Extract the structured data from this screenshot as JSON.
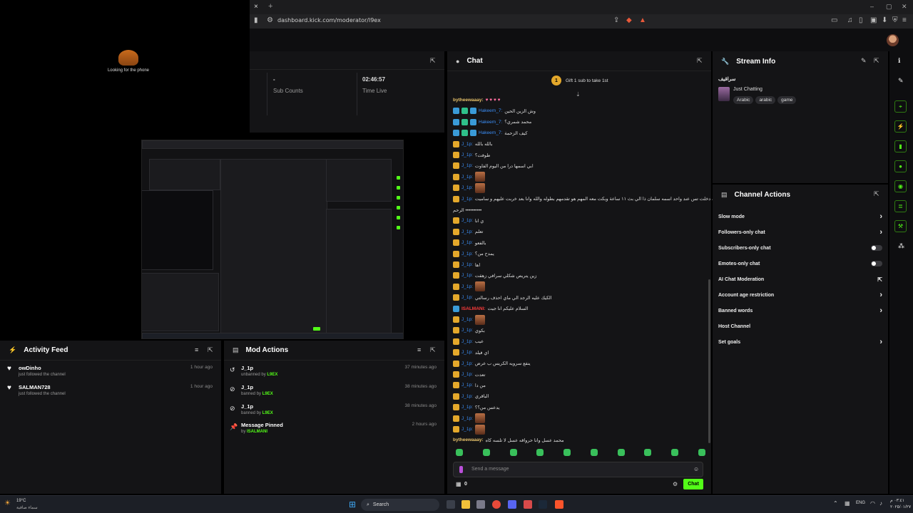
{
  "browser": {
    "url": "dashboard.kick.com/moderator/l9ex",
    "close_glyph": "×",
    "new_tab_glyph": "+"
  },
  "loading": {
    "text": "Looking for the phone"
  },
  "stats": {
    "sub_counts_value": "-",
    "sub_counts_label": "Sub Counts",
    "time_live_value": "02:46:57",
    "time_live_label": "Time Live"
  },
  "activity": {
    "title": "Activity Feed",
    "items": [
      {
        "name": "owDinho",
        "sub": "just followed the channel",
        "time": "1 hour ago"
      },
      {
        "name": "SALMAN728",
        "sub": "just followed the channel",
        "time": "1 hour ago"
      }
    ]
  },
  "mod_actions": {
    "title": "Mod Actions",
    "items": [
      {
        "user": "J_1p",
        "action": "unbanned by",
        "by": "L9EX",
        "time": "37 minutes ago"
      },
      {
        "user": "J_1p",
        "action": "banned by",
        "by": "L9EX",
        "time": "38 minutes ago"
      },
      {
        "user": "J_1p",
        "action": "banned by",
        "by": "L9EX",
        "time": "38 minutes ago"
      },
      {
        "user": "Message Pinned",
        "action": "by",
        "by": "ISALMANI",
        "time": "2 hours ago"
      }
    ]
  },
  "chat": {
    "title": "Chat",
    "gift_text": "Gift 1 sub to take 1st",
    "gift_count": "1",
    "messages": [
      {
        "user": "bytheewaaay:",
        "text": "",
        "type": "gold"
      },
      {
        "user": "Hakeem_7:",
        "text": "وش الزين الحين",
        "type": "blue"
      },
      {
        "user": "Hakeem_7:",
        "text": "محمد شمري؟",
        "type": "blue"
      },
      {
        "user": "Hakeem_7:",
        "text": "كيف الزحمة",
        "type": "blue"
      },
      {
        "user": "J_1p:",
        "text": "بالله بالله",
        "type": "crown"
      },
      {
        "user": "J_1p:",
        "text": "طوفت؟",
        "type": "crown"
      },
      {
        "user": "J_1p:",
        "text": "ابي اسمها درا من اليوم الفاوت",
        "type": "crown"
      },
      {
        "user": "J_1p:",
        "text": "",
        "type": "crown-emote"
      },
      {
        "user": "J_1p:",
        "text": "",
        "type": "crown-emote"
      },
      {
        "user": "J_1p:",
        "text": "تخيل لو انصحك دخلت تس عند واحد اسمه سلمان ذا الي بث ١١ ساعة وبكت معه المهم هو تقدمهم بطوله والله وانا بعد خربت عليهم و ساميت",
        "type": "crown"
      },
      {
        "user": "",
        "text": "الرحم ••••••••••",
        "type": "wrap"
      },
      {
        "user": "J_1p:",
        "text": "ي انا",
        "type": "crown"
      },
      {
        "user": "J_1p:",
        "text": "تعلم",
        "type": "crown"
      },
      {
        "user": "J_1p:",
        "text": "بالفعو",
        "type": "crown"
      },
      {
        "user": "J_1p:",
        "text": "يمدح من؟",
        "type": "crown"
      },
      {
        "user": "J_1p:",
        "text": "اها",
        "type": "crown"
      },
      {
        "user": "J_1p:",
        "text": "زين يتريص شكلي سرافي زهقت",
        "type": "crown"
      },
      {
        "user": "J_1p:",
        "text": "",
        "type": "crown-emote"
      },
      {
        "user": "J_1p:",
        "text": "الكيك عليه الرجد الي ماي احذف رسالتي",
        "type": "crown"
      },
      {
        "user": "ISALMANI:",
        "text": "السلام عليكم انا جيت",
        "type": "red"
      },
      {
        "user": "J_1p:",
        "text": "",
        "type": "crown-emote"
      },
      {
        "user": "J_1p:",
        "text": "بكوي",
        "type": "crown"
      },
      {
        "user": "J_1p:",
        "text": "عيب",
        "type": "crown"
      },
      {
        "user": "J_1p:",
        "text": "اي فيلد",
        "type": "crown"
      },
      {
        "user": "J_1p:",
        "text": "ينفع سرويه الكريس ب عرض",
        "type": "crown"
      },
      {
        "user": "J_1p:",
        "text": "تعدت",
        "type": "crown"
      },
      {
        "user": "J_1p:",
        "text": "من دا",
        "type": "crown"
      },
      {
        "user": "J_1p:",
        "text": "الباقري",
        "type": "crown"
      },
      {
        "user": "J_1p:",
        "text": "يدعس من؟؟",
        "type": "crown"
      },
      {
        "user": "J_1p:",
        "text": "",
        "type": "crown-emote"
      },
      {
        "user": "J_1p:",
        "text": "",
        "type": "crown-emote"
      },
      {
        "user": "bytheewaaay:",
        "text": "محمد عسل وانا حرواقه عسل لا تلسه كاه",
        "type": "gold"
      }
    ],
    "input_placeholder": "Send a message",
    "chat_button": "Chat",
    "user_count": "0"
  },
  "stream_info": {
    "title": "Stream Info",
    "stream_title": "سراقيف",
    "category": "Just Chatting",
    "tags": [
      "Arabic",
      "arabic",
      "game"
    ]
  },
  "channel_actions": {
    "title": "Channel Actions",
    "items": [
      {
        "label": "Slow mode",
        "control": "chevron"
      },
      {
        "label": "Followers-only chat",
        "control": "chevron"
      },
      {
        "label": "Subscribers-only chat",
        "control": "toggle"
      },
      {
        "label": "Emotes-only chat",
        "control": "toggle"
      },
      {
        "label": "AI Chat Moderation",
        "control": "external"
      },
      {
        "label": "Account age restriction",
        "control": "chevron"
      },
      {
        "label": "Banned words",
        "control": "chevron"
      },
      {
        "label": "Host Channel",
        "control": "none"
      },
      {
        "label": "Set goals",
        "control": "chevron"
      }
    ]
  },
  "taskbar": {
    "weather_temp": "19°C",
    "weather_desc": "سماء صافية",
    "search_label": "Search",
    "lang": "ENG",
    "time": "٠٣:٤١ م",
    "date": "٢٠٢٥/٠١/٢٧"
  },
  "colors": {
    "accent": "#53fc18",
    "background": "#141416"
  }
}
